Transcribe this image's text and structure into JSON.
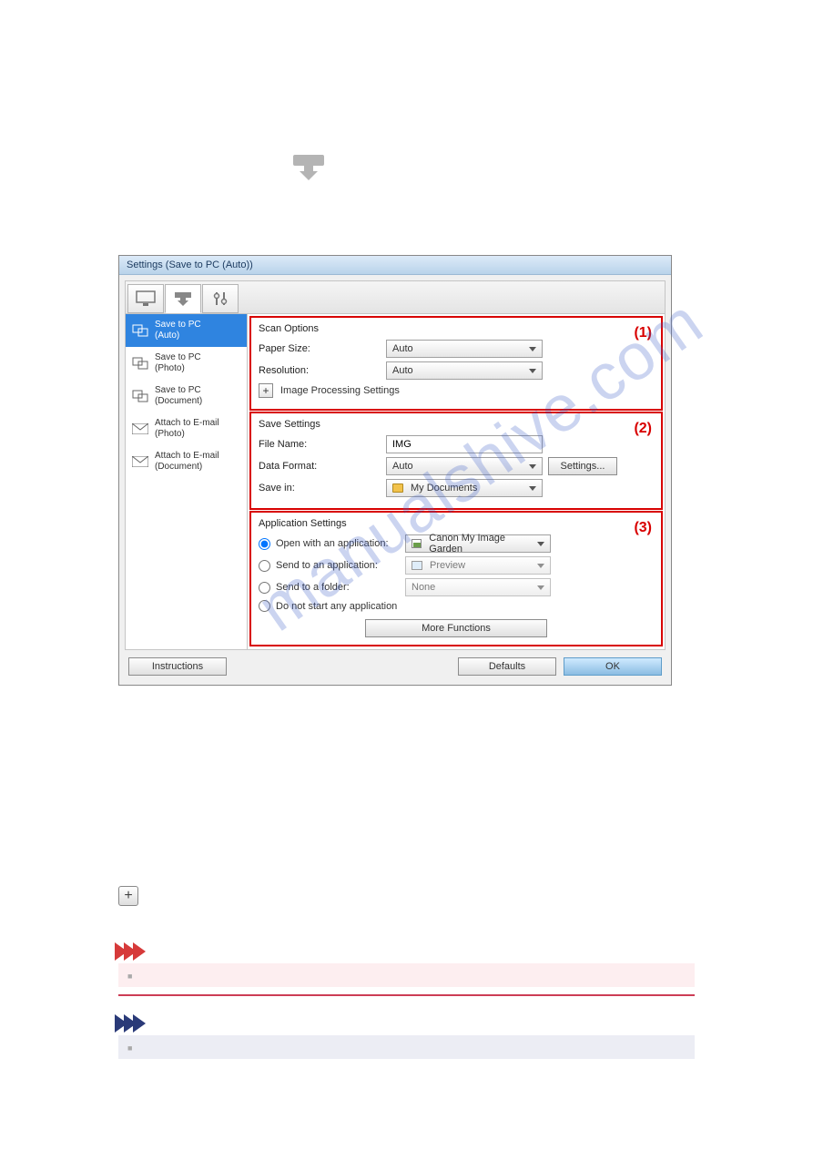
{
  "big_icon_label": "download",
  "dialog": {
    "title": "Settings (Save to PC (Auto))",
    "tabs": {
      "t1": "monitor",
      "t2": "download",
      "t3": "sliders"
    },
    "sidebar": {
      "items": [
        {
          "label": "Save to PC\n(Auto)",
          "icon": "pc"
        },
        {
          "label": "Save to PC\n(Photo)",
          "icon": "pc"
        },
        {
          "label": "Save to PC\n(Document)",
          "icon": "pc"
        },
        {
          "label": "Attach to E-mail\n(Photo)",
          "icon": "mail"
        },
        {
          "label": "Attach to E-mail\n(Document)",
          "icon": "mail"
        }
      ]
    },
    "scan": {
      "title": "Scan Options",
      "num": "(1)",
      "paper_label": "Paper Size:",
      "paper_value": "Auto",
      "res_label": "Resolution:",
      "res_value": "Auto",
      "imgproc": "Image Processing Settings"
    },
    "save": {
      "title": "Save Settings",
      "num": "(2)",
      "filename_label": "File Name:",
      "filename_value": "IMG",
      "format_label": "Data Format:",
      "format_value": "Auto",
      "settings_btn": "Settings...",
      "savein_label": "Save in:",
      "savein_value": "My Documents"
    },
    "app": {
      "title": "Application Settings",
      "num": "(3)",
      "r1": "Open with an application:",
      "r1_val": "Canon My Image Garden",
      "r2": "Send to an application:",
      "r2_val": "Preview",
      "r3": "Send to a folder:",
      "r3_val": "None",
      "r4": "Do not start any application",
      "more": "More Functions"
    },
    "footer": {
      "instructions": "Instructions",
      "defaults": "Defaults",
      "ok": "OK"
    }
  },
  "standalone_plus": "+",
  "pink_bullet": "■",
  "blue_bullet": "■",
  "watermark": "manualshive.com"
}
